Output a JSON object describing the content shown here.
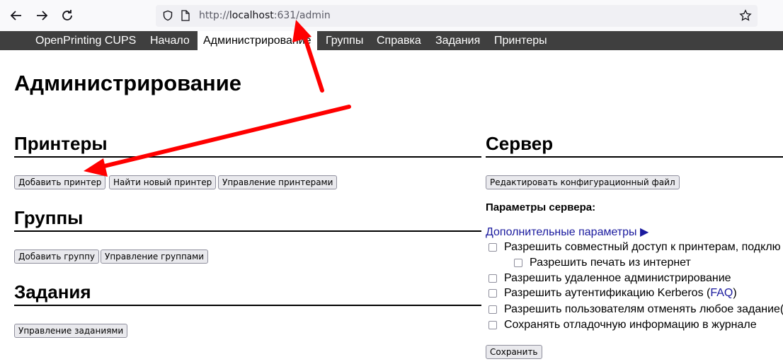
{
  "browser": {
    "url_scheme": "http://",
    "url_host": "localhost",
    "url_rest": ":631/admin",
    "icons": [
      "back-icon",
      "forward-icon",
      "reload-icon",
      "shield-icon",
      "page-icon",
      "bookmark-star-icon"
    ]
  },
  "nav": {
    "items": [
      {
        "label": "OpenPrinting CUPS"
      },
      {
        "label": "Начало"
      },
      {
        "label": "Администрирование"
      },
      {
        "label": "Группы"
      },
      {
        "label": "Справка"
      },
      {
        "label": "Задания"
      },
      {
        "label": "Принтеры"
      }
    ],
    "active_index": 2
  },
  "page": {
    "title": "Администрирование"
  },
  "printers": {
    "heading": "Принтеры",
    "buttons": [
      "Добавить принтер",
      "Найти новый принтер",
      "Управление принтерами"
    ]
  },
  "groups": {
    "heading": "Группы",
    "buttons": [
      "Добавить группу",
      "Управление группами"
    ]
  },
  "jobs": {
    "heading": "Задания",
    "buttons": [
      "Управление заданиями"
    ]
  },
  "server": {
    "heading": "Сервер",
    "edit_config_button": "Редактировать конфигурационный файл",
    "settings_label": "Параметры сервера:",
    "advanced_link": "Дополнительные параметры ▶",
    "options": [
      {
        "label": "Разрешить совместный доступ к принтерам, подклю",
        "checked": false
      },
      {
        "label": "Разрешить печать из интернет",
        "checked": false
      },
      {
        "label": "Разрешить удаленное администрирование",
        "checked": false
      },
      {
        "label": "Разрешить аутентификацию Kerberos (",
        "link": "FAQ",
        "after": ")",
        "checked": false
      },
      {
        "label": "Разрешить пользователям отменять любое задание(",
        "checked": false
      },
      {
        "label": "Сохранять отладочную информацию в журнале",
        "checked": false
      }
    ],
    "save_button": "Сохранить"
  },
  "annotation_color": "#ff0000"
}
